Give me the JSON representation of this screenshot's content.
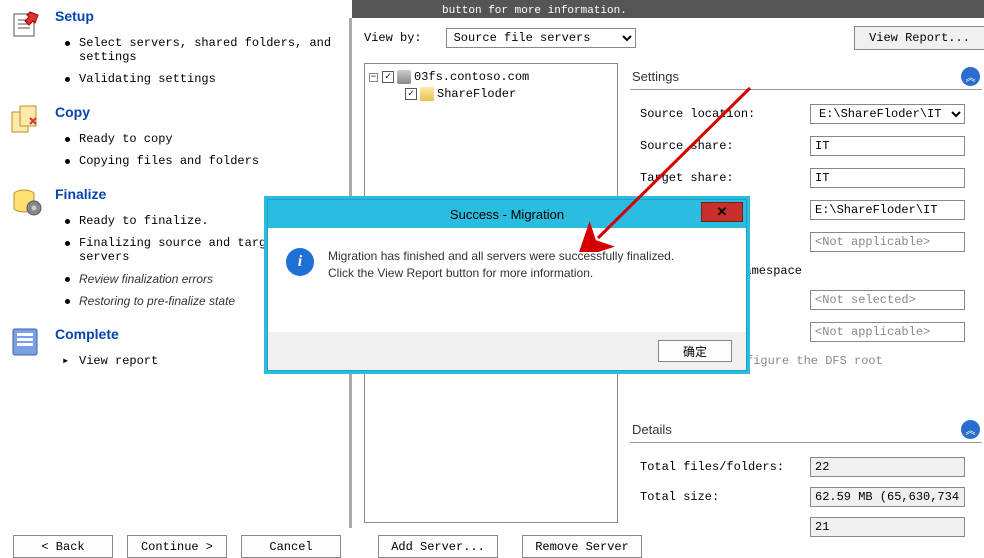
{
  "banner": {
    "text": "button for more information."
  },
  "sidebar": {
    "setup": {
      "title": "Setup",
      "items": [
        "Select servers, shared folders, and settings",
        "Validating settings"
      ]
    },
    "copy": {
      "title": "Copy",
      "items": [
        "Ready to copy",
        "Copying files and folders"
      ]
    },
    "finalize": {
      "title": "Finalize",
      "items": [
        "Ready to finalize.",
        "Finalizing source and target file servers",
        "Review finalization errors",
        "Restoring to pre-finalize state"
      ]
    },
    "complete": {
      "title": "Complete",
      "items": [
        "View report"
      ]
    }
  },
  "viewby": {
    "label": "View by:",
    "selected": "Source file servers"
  },
  "view_report_btn": "View Report...",
  "tree": {
    "root": "03fs.contoso.com",
    "child": "ShareFloder"
  },
  "settings": {
    "header": "Settings",
    "source_location_label": "Source location:",
    "source_location_value": "E:\\ShareFloder\\IT",
    "source_share_label": "Source share:",
    "source_share_value": "IT",
    "target_share_label": "Target share:",
    "target_share_value": "IT",
    "unc_value": "E:\\ShareFloder\\IT",
    "not_applicable": "<Not applicable>",
    "namespace_label": "namespace",
    "not_selected": "<Not selected>",
    "note": "figure the DFS root"
  },
  "details": {
    "header": "Details",
    "total_files_label": "Total files/folders:",
    "total_files_value": "22",
    "total_size_label": "Total size:",
    "total_size_value": "62.59 MB (65,630,734",
    "row3_value": "21"
  },
  "modal": {
    "title": "Success - Migration",
    "line1": "Migration has finished and all servers were successfully finalized.",
    "line2": "Click the View Report button for more information.",
    "ok": "确定"
  },
  "buttons": {
    "back": "< Back",
    "continue": "Continue >",
    "cancel": "Cancel",
    "add_server": "Add Server...",
    "remove_server": "Remove Server"
  }
}
